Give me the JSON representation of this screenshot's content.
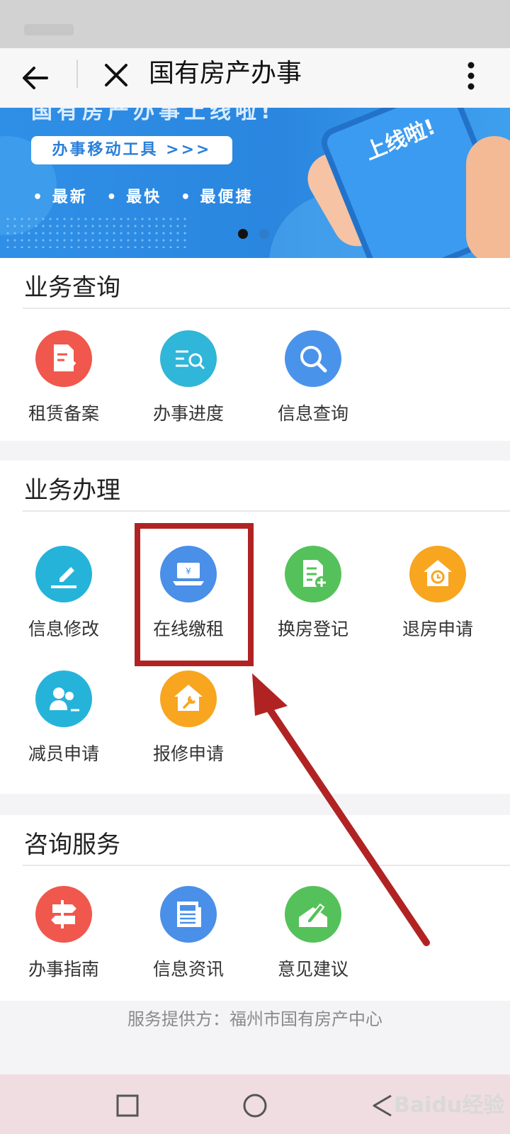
{
  "app": {
    "title": "国有房产办事"
  },
  "banner": {
    "headline": "国有房产办事上线啦!",
    "pill": "办事移动工具 >>>",
    "bullets": [
      "• 最新",
      "• 最快",
      "• 最便捷"
    ],
    "phone_text": "上线啦!",
    "active_slide": 1,
    "slide_count": 2
  },
  "sections": {
    "query": {
      "title": "业务查询",
      "items": [
        {
          "label": "租赁备案",
          "icon": "lease-filing-icon",
          "color": "#f0574d"
        },
        {
          "label": "办事进度",
          "icon": "progress-search-icon",
          "color": "#2fb6d8"
        },
        {
          "label": "信息查询",
          "icon": "magnifier-icon",
          "color": "#4a93ea"
        }
      ]
    },
    "handle": {
      "title": "业务办理",
      "items": [
        {
          "label": "信息修改",
          "icon": "pencil-icon",
          "color": "#26b3da"
        },
        {
          "label": "在线缴租",
          "icon": "laptop-yen-icon",
          "color": "#4a8fe8"
        },
        {
          "label": "换房登记",
          "icon": "document-add-icon",
          "color": "#55c15a"
        },
        {
          "label": "退房申请",
          "icon": "house-clock-icon",
          "color": "#f8a520"
        },
        {
          "label": "减员申请",
          "icon": "users-minus-icon",
          "color": "#26b3da"
        },
        {
          "label": "报修申请",
          "icon": "house-wrench-icon",
          "color": "#f8a520"
        }
      ]
    },
    "consult": {
      "title": "咨询服务",
      "items": [
        {
          "label": "办事指南",
          "icon": "signpost-icon",
          "color": "#f0574d"
        },
        {
          "label": "信息资讯",
          "icon": "newspaper-icon",
          "color": "#4a8fe8"
        },
        {
          "label": "意见建议",
          "icon": "envelope-pen-icon",
          "color": "#55c15a"
        }
      ]
    }
  },
  "footer": {
    "provider": "服务提供方：福州市国有房产中心"
  },
  "watermark": "Baidu经验",
  "colors": {
    "annotation": "#b12323",
    "banner": "#2f8fe6"
  }
}
